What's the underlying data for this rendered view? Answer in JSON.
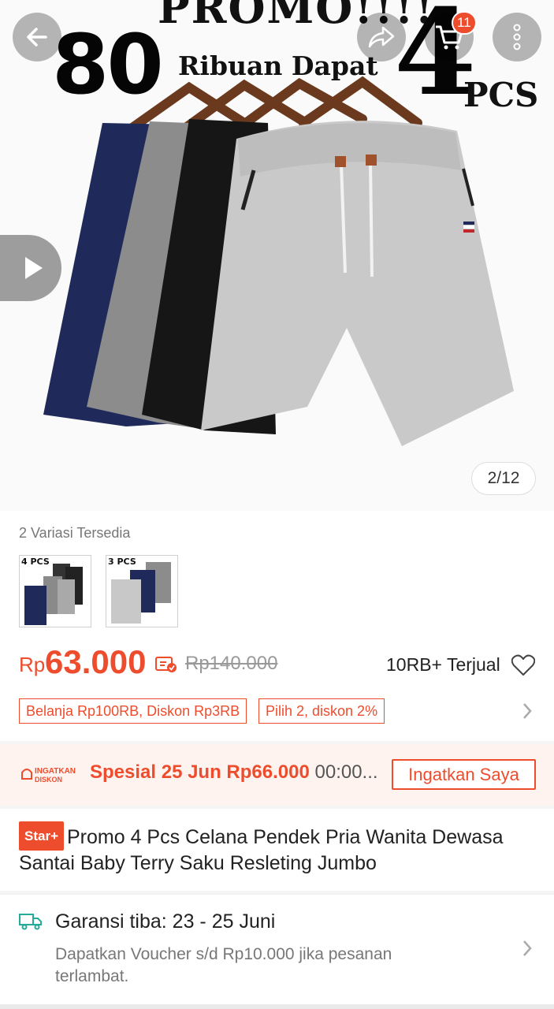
{
  "hero": {
    "promo_top": "PROMO!!!!",
    "promo_80": "80",
    "promo_mid": "Ribuan Dapat",
    "promo_4": "4",
    "promo_pcs": "PCS",
    "image_counter": "2/12"
  },
  "toolbar": {
    "cart_count": "11"
  },
  "variants": {
    "label": "2 Variasi Tersedia",
    "items": [
      {
        "tag": "4 PCS"
      },
      {
        "tag": "3 PCS"
      }
    ]
  },
  "price": {
    "currency": "Rp",
    "current": "63.000",
    "original": "Rp140.000",
    "sold": "10RB+ Terjual"
  },
  "vouchers": [
    "Belanja Rp100RB, Diskon Rp3RB",
    "Pilih 2, diskon 2%"
  ],
  "reminder": {
    "logo_top": "INGATKAN",
    "logo_bottom": "DISKON",
    "text": "Spesial 25 Jun ",
    "price": "Rp66.000",
    "time": " 00:00...",
    "button": "Ingatkan Saya"
  },
  "product": {
    "badge": "Star+",
    "title": "Promo 4 Pcs Celana Pendek Pria Wanita Dewasa Santai Baby Terry Saku Resleting Jumbo"
  },
  "shipping": {
    "title": "Garansi tiba: 23 - 25 Juni",
    "subtitle": "Dapatkan Voucher s/d Rp10.000 jika pesanan terlambat."
  },
  "colors": {
    "accent": "#ee4d2d",
    "teal": "#26aa99"
  },
  "icons": [
    "back-arrow-icon",
    "share-icon",
    "cart-icon",
    "more-icon",
    "play-icon",
    "heart-icon",
    "chevron-right-icon",
    "truck-icon",
    "coin-icon"
  ]
}
